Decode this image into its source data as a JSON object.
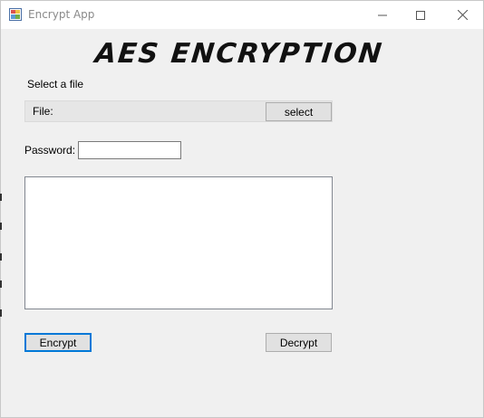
{
  "window": {
    "title": "Encrypt App",
    "controls": {
      "minimize_icon": "minimize-icon",
      "maximize_icon": "maximize-icon",
      "close_icon": "close-icon"
    }
  },
  "main": {
    "heading": "AES ENCRYPTION",
    "select_file_label": "Select a file",
    "file_label": "File:",
    "select_button": "select",
    "password_label": "Password:",
    "password_value": "",
    "text_content": "",
    "encrypt_button": "Encrypt",
    "decrypt_button": "Decrypt"
  },
  "colors": {
    "accent": "#0078d7",
    "background": "#f0f0f0",
    "titlebar": "#ffffff"
  }
}
